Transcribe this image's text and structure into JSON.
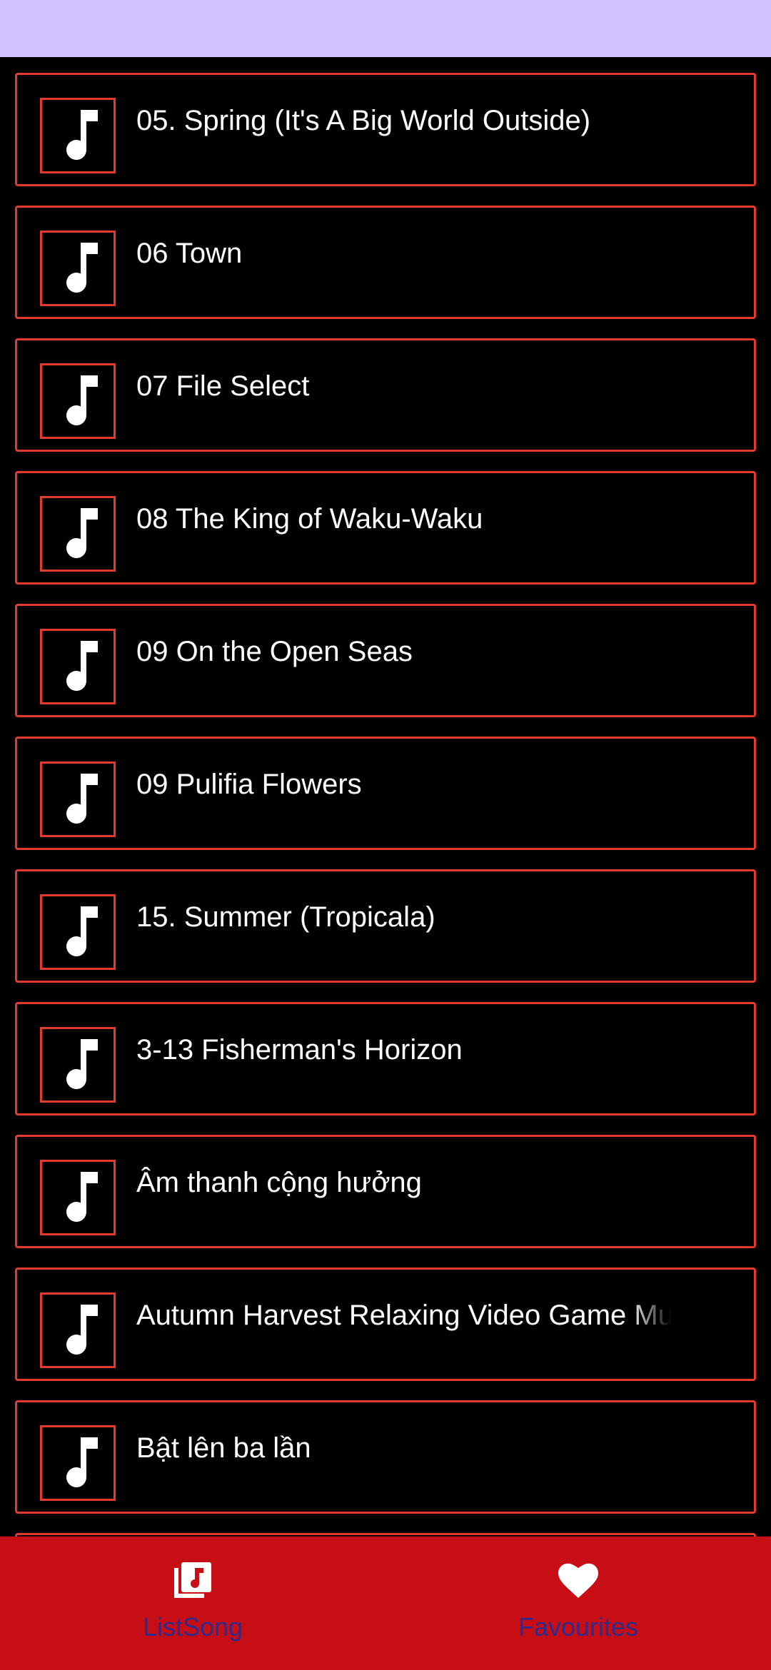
{
  "colors": {
    "status_bar": "#d1c4ff",
    "item_border": "#e23a2e",
    "nav_background": "#c70e14",
    "nav_label": "#2f2a8c"
  },
  "songs": [
    {
      "title": "05. Spring (It's A Big World Outside)",
      "icon": "music-note-icon"
    },
    {
      "title": "06 Town",
      "icon": "music-note-icon"
    },
    {
      "title": "07 File Select",
      "icon": "music-note-icon"
    },
    {
      "title": "08 The King of Waku-Waku",
      "icon": "music-note-icon"
    },
    {
      "title": "09 On the Open Seas",
      "icon": "music-note-icon"
    },
    {
      "title": "09 Pulifia Flowers",
      "icon": "music-note-icon"
    },
    {
      "title": "15. Summer (Tropicala)",
      "icon": "music-note-icon"
    },
    {
      "title": "3-13 Fisherman's Horizon",
      "icon": "music-note-icon"
    },
    {
      "title": "Âm thanh cộng hưởng",
      "icon": "music-note-icon"
    },
    {
      "title": "Autumn Harvest  Relaxing Video Game Music",
      "icon": "music-note-icon"
    },
    {
      "title": "Bật lên ba lần",
      "icon": "music-note-icon"
    },
    {
      "title": "",
      "icon": "music-note-icon"
    }
  ],
  "bottom_nav": {
    "items": [
      {
        "label": "ListSong",
        "icon": "music-library-icon"
      },
      {
        "label": "Favourites",
        "icon": "heart-icon"
      }
    ]
  }
}
